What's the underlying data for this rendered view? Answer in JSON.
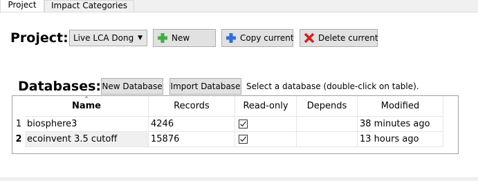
{
  "tabs": [
    {
      "label": "Project",
      "active": true
    },
    {
      "label": "Impact Categories",
      "active": false
    }
  ],
  "project": {
    "heading": "Project:",
    "selected": "Live LCA Dong",
    "new_label": "New",
    "copy_label": "Copy current",
    "delete_label": "Delete current"
  },
  "databases": {
    "heading": "Databases:",
    "new_db_label": "New Database",
    "import_db_label": "Import Database",
    "hint": "Select a database (double-click on table)."
  },
  "table": {
    "columns": [
      "Name",
      "Records",
      "Read-only",
      "Depends",
      "Modified"
    ],
    "rows": [
      {
        "num": "1",
        "name": "biosphere3",
        "records": "4246",
        "read_only": true,
        "depends": "",
        "modified": "38 minutes ago"
      },
      {
        "num": "2",
        "name": "ecoinvent 3.5 cutoff",
        "records": "15876",
        "read_only": true,
        "depends": "",
        "modified": "13 hours ago"
      }
    ]
  },
  "icons": {
    "new": "plus-green-icon",
    "copy": "plus-blue-icon",
    "delete": "x-red-icon",
    "sort": "sort-up-icon",
    "dropdown": "chevron-down-icon"
  },
  "colors": {
    "new_icon": "#3cb043",
    "copy_icon": "#2f6fd6",
    "delete_icon": "#d81e1e"
  }
}
